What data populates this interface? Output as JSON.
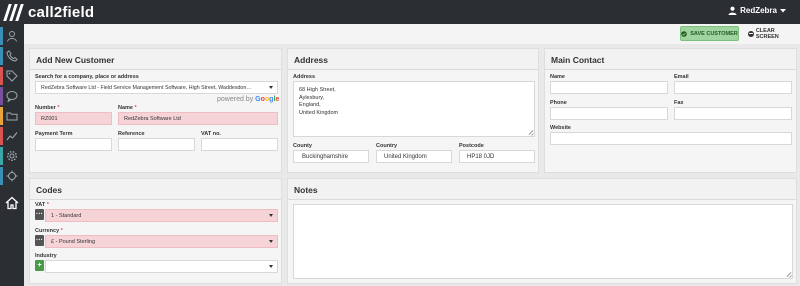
{
  "app": {
    "brand": "call2field",
    "user": "RedZebra"
  },
  "sidebar": {
    "items": [
      {
        "icon": "user-icon",
        "color": "#3a8fb7"
      },
      {
        "icon": "phone-icon",
        "color": "#3a8fb7"
      },
      {
        "icon": "tag-icon",
        "color": "#d9534f"
      },
      {
        "icon": "chat-icon",
        "color": "#7b4fa0"
      },
      {
        "icon": "folder-icon",
        "color": "#e8a43a"
      },
      {
        "icon": "chart-icon",
        "color": "#d9534f"
      },
      {
        "icon": "gear-icon",
        "color": "#3aa8a8"
      },
      {
        "icon": "crosshair-icon",
        "color": "#3a8fb7"
      },
      {
        "icon": "home-icon",
        "color": "#ffffff"
      }
    ]
  },
  "actions": {
    "save": "SAVE CUSTOMER",
    "clear": "CLEAR SCREEN"
  },
  "customer": {
    "title": "Add New Customer",
    "search_label": "Search for a company, place or address",
    "search_value": "RedZebra Software Ltd - Field Service Management Software, High Street, Waddesdon…",
    "powered_by": "powered by",
    "google": [
      "G",
      "o",
      "o",
      "g",
      "l",
      "e"
    ],
    "number_label": "Number",
    "number_value": "RZ001",
    "name_label": "Name",
    "name_value": "RedZebra Software Ltd",
    "payment_term_label": "Payment Term",
    "reference_label": "Reference",
    "vat_no_label": "VAT no.",
    "req_mark": "*"
  },
  "address": {
    "title": "Address",
    "address_label": "Address",
    "lines": [
      "68 High Street,",
      "Aylesbury,",
      "England,",
      "United Kingdom"
    ],
    "county_label": "County",
    "county_value": "Buckinghamshire",
    "country_label": "Country",
    "country_value": "United Kingdom",
    "postcode_label": "Postcode",
    "postcode_value": "HP18 0JD"
  },
  "contact": {
    "title": "Main Contact",
    "name_label": "Name",
    "email_label": "Email",
    "phone_label": "Phone",
    "fax_label": "Fax",
    "website_label": "Website"
  },
  "codes": {
    "title": "Codes",
    "vat_label": "VAT",
    "vat_value": "1 - Standard",
    "currency_label": "Currency",
    "currency_value": "£ - Pound Sterling",
    "industry_label": "Industry",
    "dots": "···",
    "plus": "+"
  },
  "notes": {
    "title": "Notes"
  }
}
